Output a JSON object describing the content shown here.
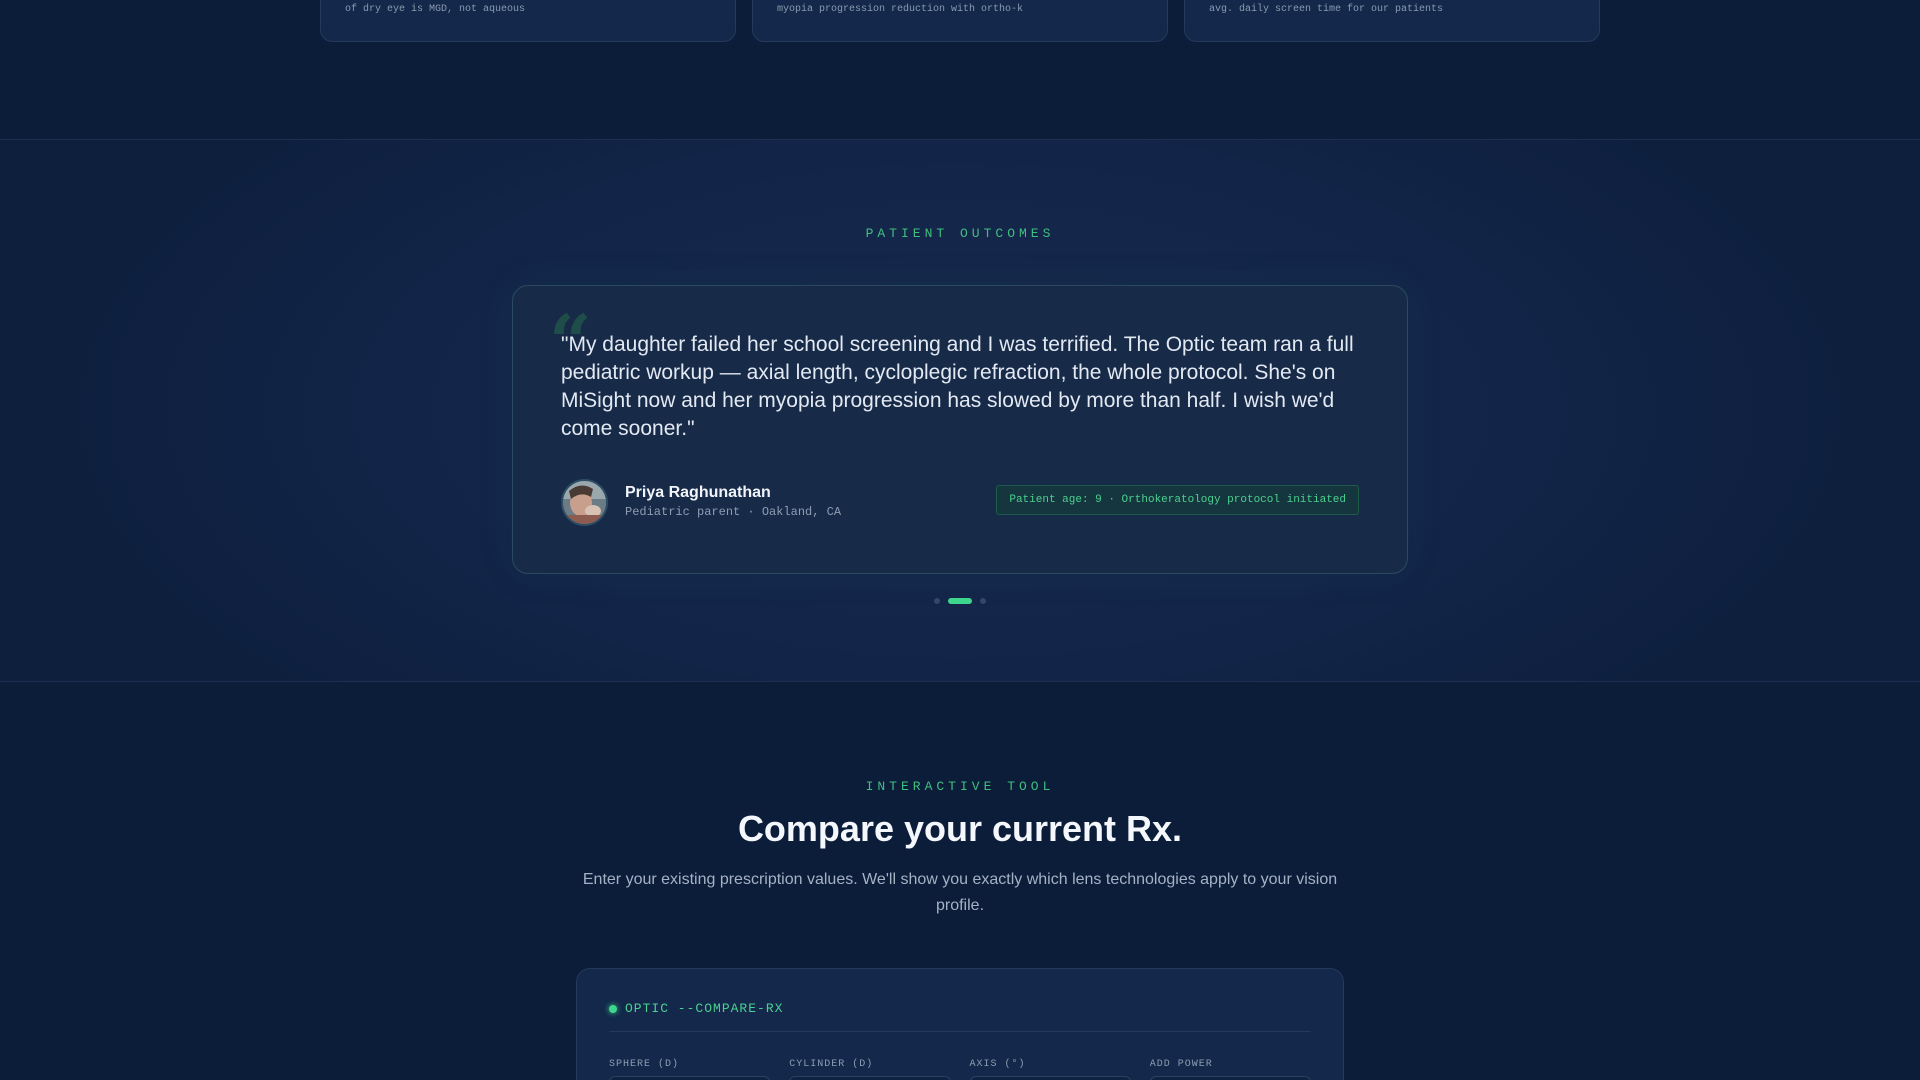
{
  "stats": [
    {
      "caption": "of dry eye is MGD, not aqueous"
    },
    {
      "caption": "myopia progression reduction with ortho-k"
    },
    {
      "caption": "avg. daily screen time for our patients"
    }
  ],
  "outcomes": {
    "eyebrow": "PATIENT OUTCOMES",
    "quote": "\"My daughter failed her school screening and I was terrified. The Optic team ran a full pediatric workup — axial length, cycloplegic refraction, the whole protocol. She's on MiSight now and her myopia progression has slowed by more than half. I wish we'd come sooner.\"",
    "author_name": "Priya Raghunathan",
    "author_role": "Pediatric parent · Oakland, CA",
    "tag": "Patient age: 9 · Orthokeratology protocol initiated",
    "active_slide": 2,
    "slide_count": 3
  },
  "tool": {
    "eyebrow": "INTERACTIVE TOOL",
    "title": "Compare your current Rx.",
    "subtitle": "Enter your existing prescription values. We'll show you exactly which lens technologies apply to your vision profile.",
    "panel_title": "OPTIC --COMPARE-RX",
    "fields": [
      {
        "label": "SPHERE (D)"
      },
      {
        "label": "CYLINDER (D)"
      },
      {
        "label": "AXIS (°)"
      },
      {
        "label": "ADD POWER"
      }
    ]
  },
  "colors": {
    "accent": "#3dd68c",
    "background": "#0c1d3a",
    "card": "#172a48"
  }
}
